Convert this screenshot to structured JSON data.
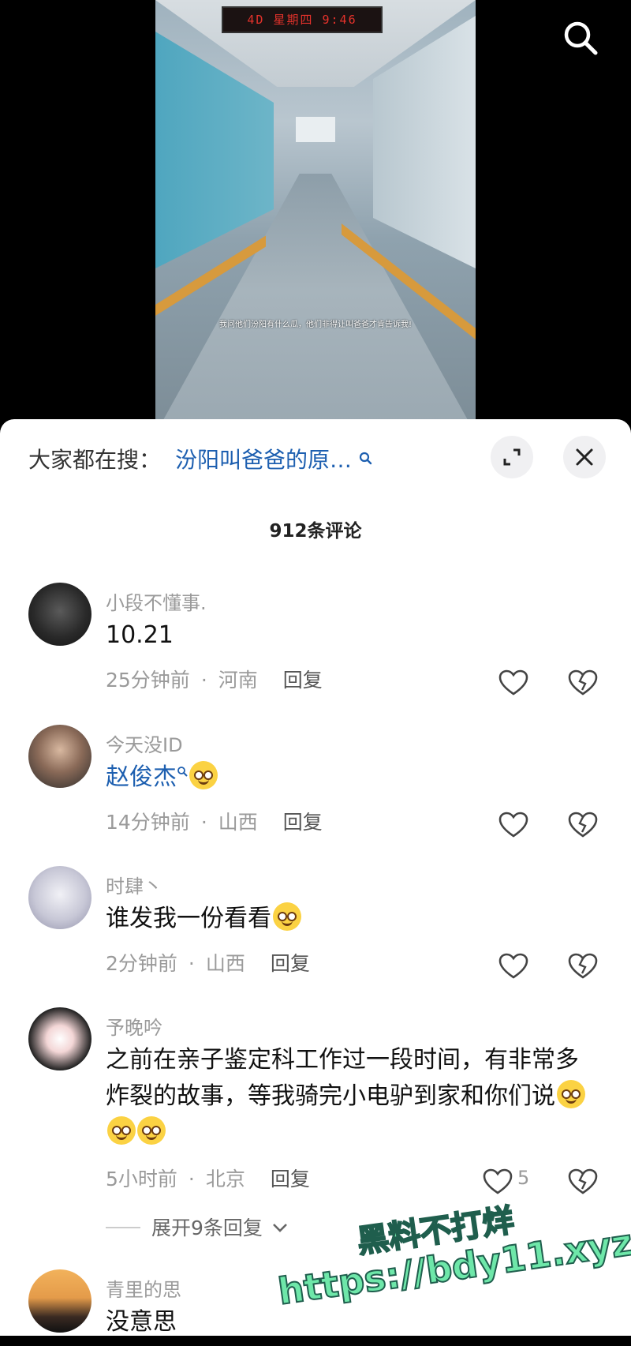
{
  "video": {
    "led_text": "4D 星期四 9:46",
    "caption": "我问他们汾阳有什么瓜，他们非得让叫爸爸才肯告诉我!"
  },
  "icons": {
    "top_search": "search-icon",
    "expand": "expand-icon",
    "close": "close-icon",
    "like": "heart-icon",
    "dislike": "broken-heart-icon",
    "chevron": "chevron-down-icon"
  },
  "sheet": {
    "suggest_label": "大家都在搜：",
    "suggest_term": "汾阳叫爸爸的原…",
    "comment_count": "912条评论"
  },
  "comments": [
    {
      "user": "小段不懂事.",
      "text": "10.21",
      "time": "25分钟前",
      "sep": "·",
      "location": "河南",
      "reply": "回复"
    },
    {
      "user": "今天没ID",
      "text": "赵俊杰",
      "time": "14分钟前",
      "sep": "·",
      "location": "山西",
      "reply": "回复"
    },
    {
      "user": "时肆丶",
      "text": "谁发我一份看看",
      "time": "2分钟前",
      "sep": "·",
      "location": "山西",
      "reply": "回复"
    },
    {
      "user": "予晚吟",
      "text": "之前在亲子鉴定科工作过一段时间，有非常多炸裂的故事，等我骑完小电驴到家和你们说",
      "time": "5小时前",
      "sep": "·",
      "location": "北京",
      "reply": "回复",
      "likes": "5",
      "expand": "展开9条回复"
    },
    {
      "user": "青里的思",
      "text": "没意思"
    }
  ],
  "watermark": {
    "line1": "黑料不打烊",
    "line2": "https://bdy11.xyz"
  },
  "colors": {
    "link": "#1d5fb0",
    "watermark": "#6ee7a9"
  }
}
